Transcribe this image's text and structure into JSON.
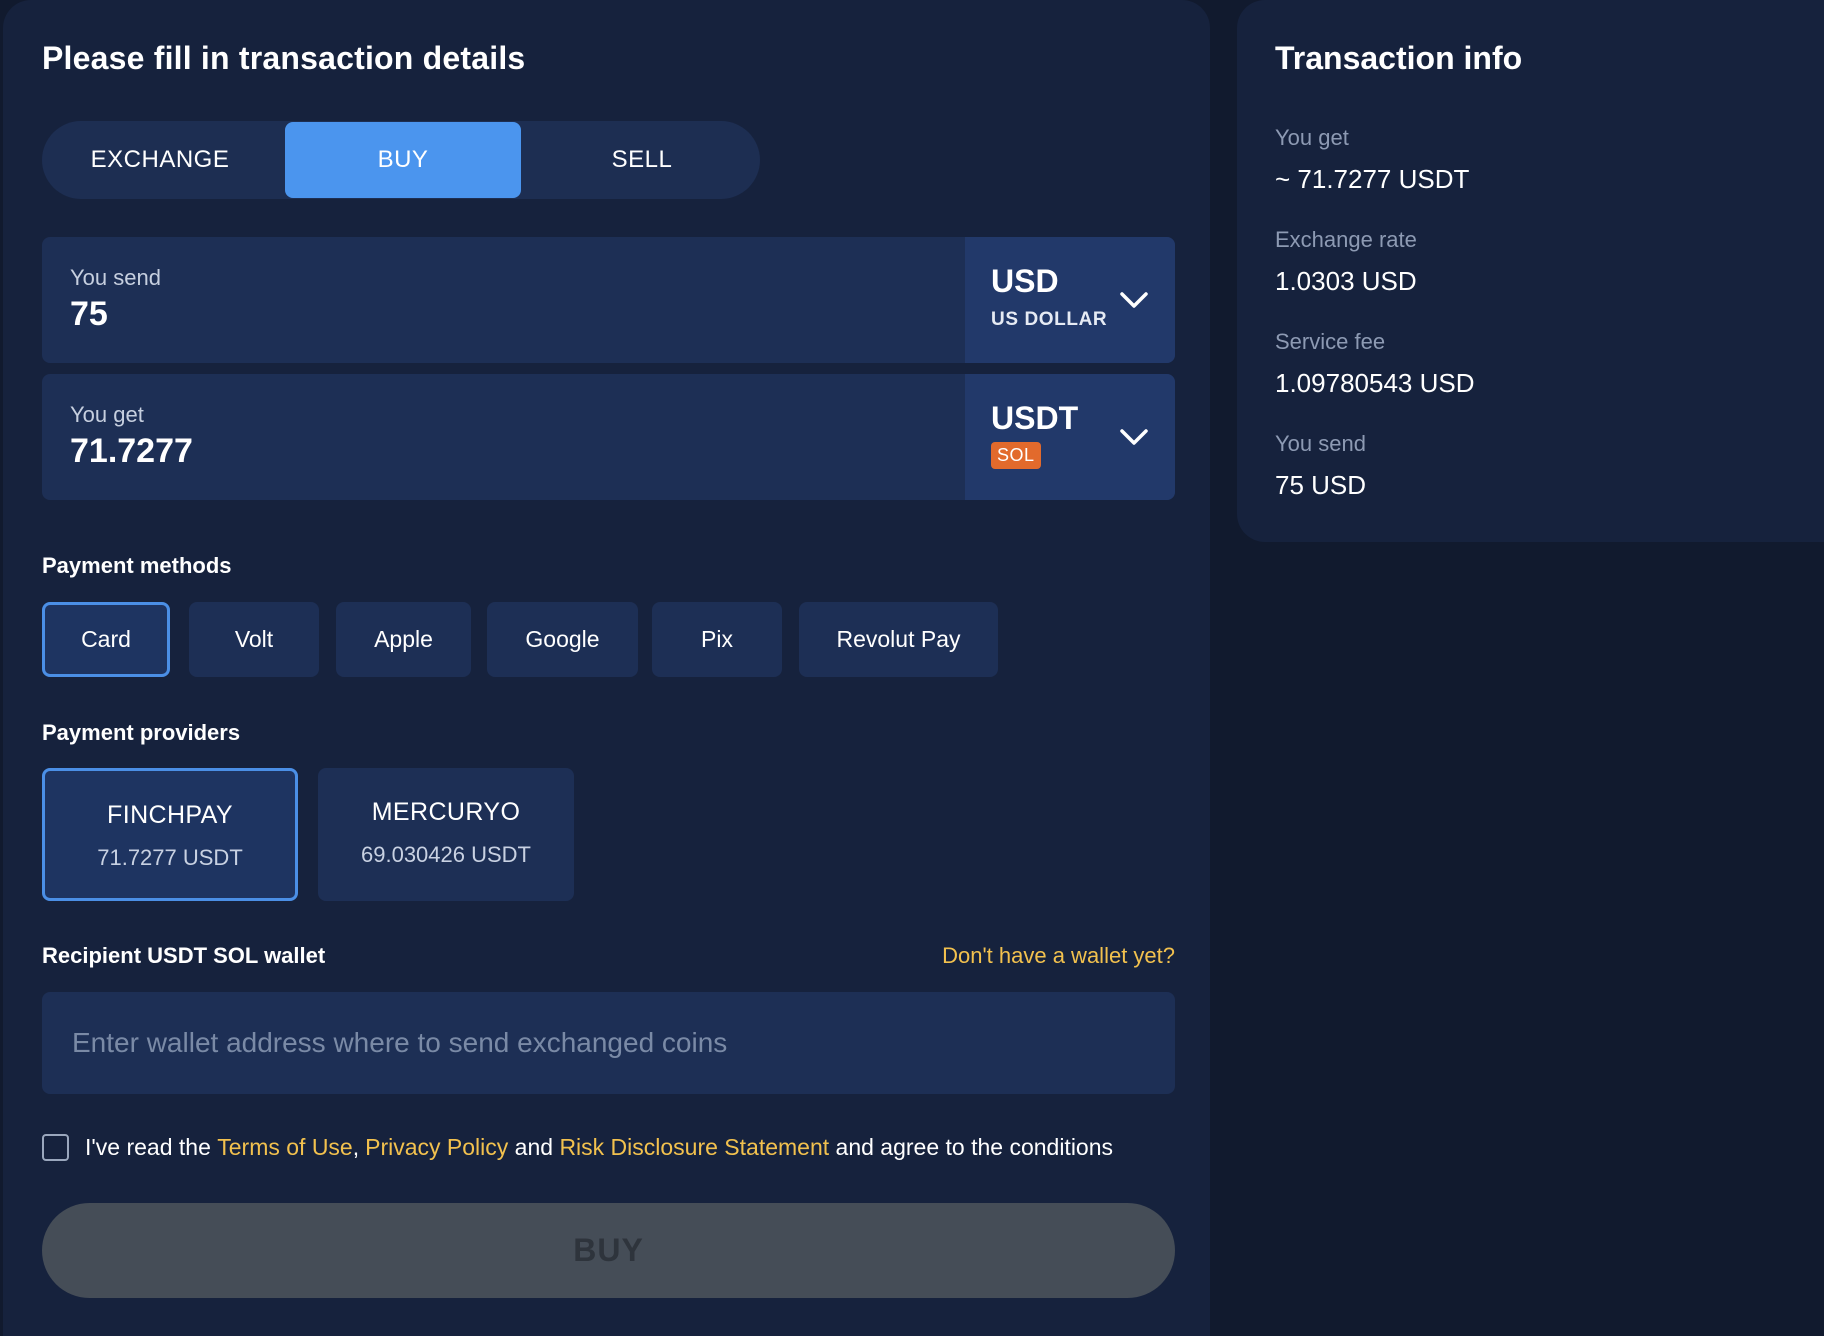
{
  "form": {
    "title": "Please fill in transaction details",
    "tabs": [
      "EXCHANGE",
      "BUY",
      "SELL"
    ],
    "active_tab": "BUY",
    "send": {
      "label": "You send",
      "value": "75",
      "currency_code": "USD",
      "currency_name": "US DOLLAR"
    },
    "get": {
      "label": "You get",
      "value": "71.7277",
      "currency_code": "USDT",
      "network": "SOL"
    },
    "payment_methods_label": "Payment methods",
    "payment_methods": [
      "Card",
      "Volt",
      "Apple",
      "Google",
      "Pix",
      "Revolut Pay"
    ],
    "selected_payment_method": "Card",
    "payment_providers_label": "Payment providers",
    "providers": [
      {
        "name": "FINCHPAY",
        "amount": "71.7277 USDT"
      },
      {
        "name": "MERCURYO",
        "amount": "69.030426 USDT"
      }
    ],
    "selected_provider": "FINCHPAY",
    "wallet_label": "Recipient USDT SOL wallet",
    "wallet_link": "Don't have a wallet yet?",
    "wallet_placeholder": "Enter wallet address where to send exchanged coins",
    "agree": {
      "prefix": "I've read the ",
      "terms": "Terms of Use",
      "comma": ",",
      "privacy": "Privacy Policy",
      "and": " and ",
      "risk": "Risk Disclosure Statement",
      "suffix": " and agree to the conditions"
    },
    "submit_label": "BUY"
  },
  "info": {
    "title": "Transaction info",
    "rows": [
      {
        "label": "You get",
        "value": "~ 71.7277 USDT"
      },
      {
        "label": "Exchange rate",
        "value": "1.0303 USD"
      },
      {
        "label": "Service fee",
        "value": "1.09780543 USD"
      },
      {
        "label": "You send",
        "value": "75 USD"
      }
    ]
  },
  "colors": {
    "background": "#111a2e",
    "panel": "#16223d",
    "accent_blue": "#4b95ee",
    "link_yellow": "#f2c14e",
    "network_badge": "#e26a2c",
    "disabled_button": "#454d57"
  },
  "icons": {
    "currency_dropdown": "chevron-down-icon"
  }
}
